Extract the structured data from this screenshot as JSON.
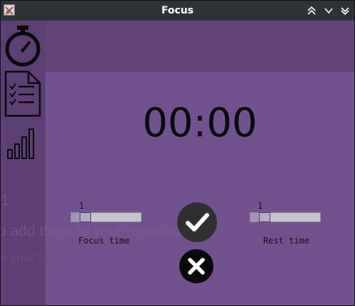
{
  "window": {
    "title": "Focus",
    "controls": [
      "keep-above-icon",
      "minimize-icon",
      "close-chevron-icon"
    ]
  },
  "sidebar": {
    "items": [
      {
        "name": "timer",
        "icon": "stopwatch-icon"
      },
      {
        "name": "tasks",
        "icon": "checklist-icon"
      },
      {
        "name": "statistics",
        "icon": "bar-chart-icon"
      }
    ]
  },
  "overlay": {
    "line1": "1",
    "line2": "o add them to your repository",
    "line3": "e your task"
  },
  "timer": {
    "display": "00:00"
  },
  "focus": {
    "value": "1",
    "level": 0.14,
    "label": "Focus time"
  },
  "rest": {
    "value": "1",
    "level": 0.14,
    "label": "Rest time"
  },
  "actions": {
    "confirm_icon": "checkmark-icon",
    "cancel_icon": "x-icon"
  },
  "colors": {
    "titlebar": "#2f3338",
    "sidebar": "#5d4073",
    "main": "#72528e",
    "accent_dark": "#303030"
  }
}
